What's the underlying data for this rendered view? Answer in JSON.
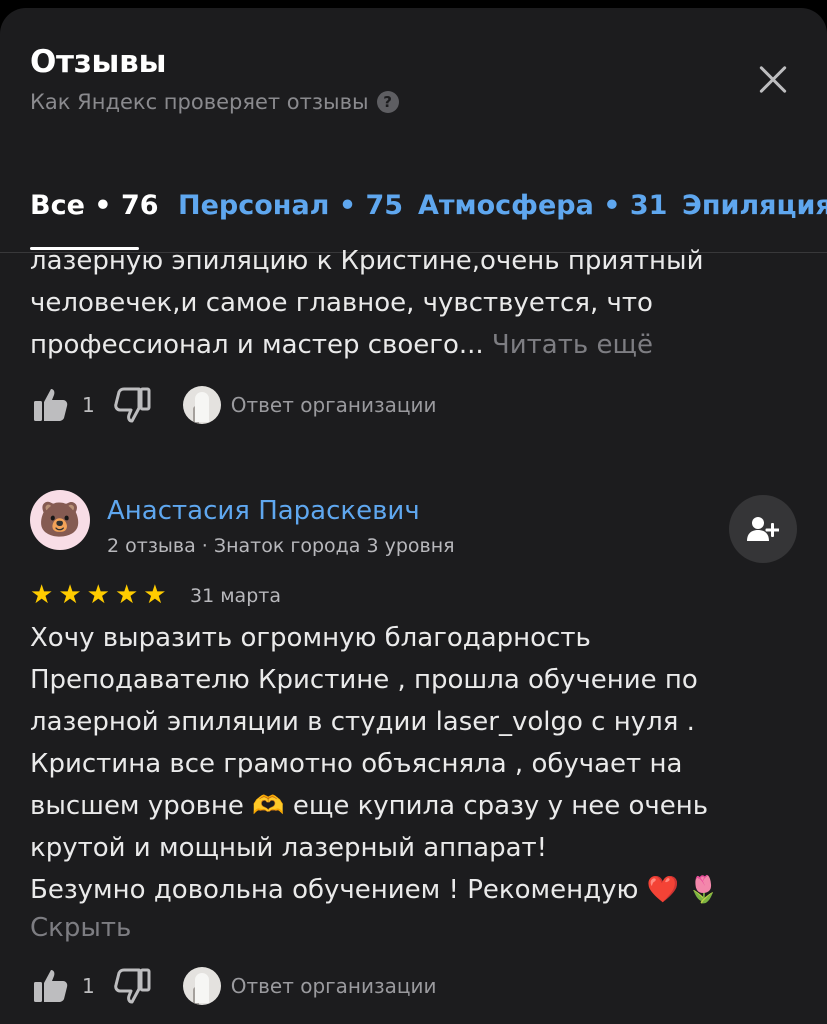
{
  "header": {
    "title": "Отзывы",
    "subtitle": "Как Яндекс проверяет отзывы",
    "help_icon": "question-circle-icon",
    "close_icon": "close-icon"
  },
  "tabs": [
    {
      "label": "Все • 76",
      "active": true
    },
    {
      "label": "Персонал • 75",
      "active": false
    },
    {
      "label": "Атмосфера • 31",
      "active": false
    },
    {
      "label": "Эпиляция",
      "active": false
    }
  ],
  "review_prev": {
    "lines": [
      "лазерную эпиляцию к Кристине,очень приятный",
      "человечек,и самое главное, чувствуется, что",
      "профессионал и мастер своего..."
    ],
    "read_more": "Читать ещё",
    "likes": "1",
    "org_reply": "Ответ организации"
  },
  "review": {
    "author_name": "Анастасия Параскевич",
    "author_avatar": "🐻",
    "author_meta": "2 отзыва · Знаток города 3 уровня",
    "rating": 5,
    "date": "31 марта",
    "lines": [
      "Хочу выразить огромную благодарность",
      "Преподавателю Кристине , прошла обучение по",
      "лазерной эпиляции в студии laser_volgo с нуля .",
      "Кристина все грамотно объясняла , обучает на",
      "высшем уровне 🫶 еще купила сразу у нее очень",
      "крутой и мощный лазерный аппарат!",
      "Безумно довольна обучением ! Рекомендую ❤️ 🌷"
    ],
    "hide_label": "Скрыть",
    "likes": "1",
    "org_reply": "Ответ организации"
  },
  "colors": {
    "background": "#1c1c1e",
    "accent": "#5fa7ef",
    "star": "#ffcc00",
    "muted": "#8a8a8e"
  }
}
